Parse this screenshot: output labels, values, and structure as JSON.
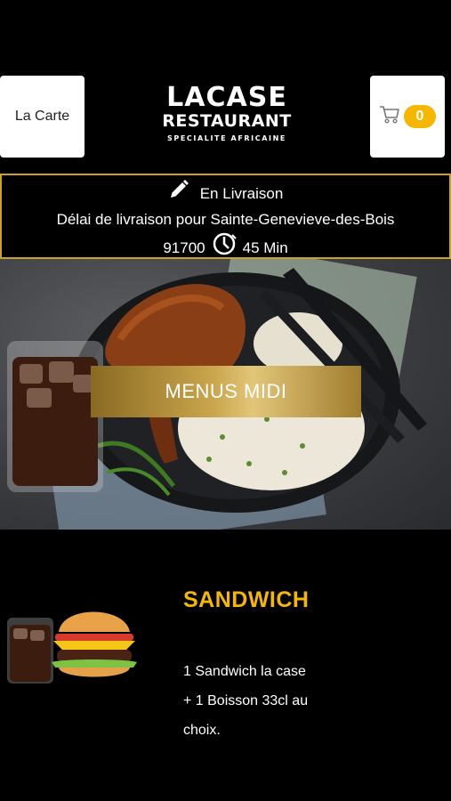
{
  "header": {
    "menu_button_label": "La Carte",
    "logo": {
      "line1": "LACASE",
      "line2": "RESTAURANT",
      "line3": "SPECIALITE AFRICAINE"
    },
    "cart_count": "0",
    "cart_icon": "cart-icon",
    "accent_color": "#f5b700"
  },
  "delivery": {
    "mode_icon": "pencil-icon",
    "mode_label": "En Livraison",
    "delay_text": "Délai de livraison pour Sainte-Genevieve-des-Bois",
    "postal_code": "91700",
    "clock_icon": "clock-icon",
    "duration": "45 Min",
    "border_color": "#c9a227"
  },
  "hero": {
    "cta_label": "MENUS MIDI"
  },
  "product": {
    "title": "SANDWICH",
    "desc_line1": "1 Sandwich la case",
    "desc_line2": "+ 1 Boisson 33cl au",
    "desc_line3": "choix."
  }
}
